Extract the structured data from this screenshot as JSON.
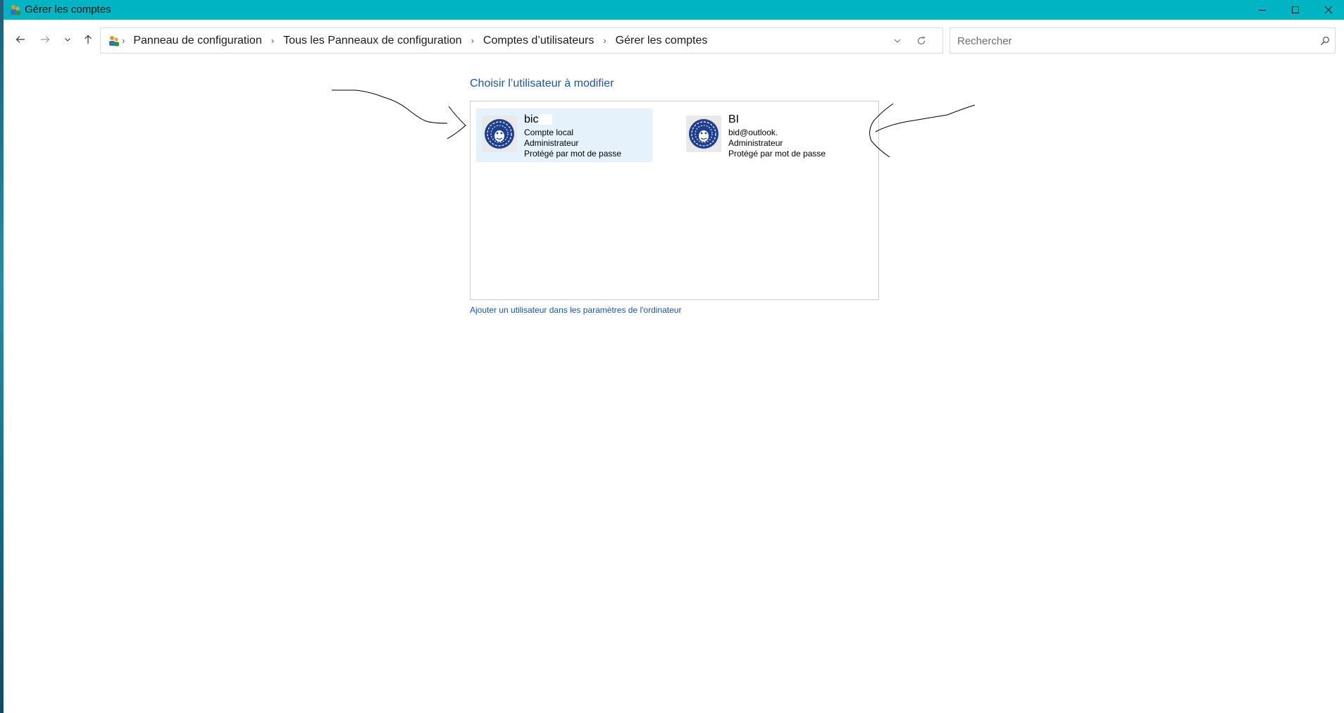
{
  "window": {
    "title": "Gérer les comptes",
    "icon": "user-accounts-icon"
  },
  "titlebar": {
    "minimize_icon": "minimize-icon",
    "maximize_icon": "maximize-icon",
    "close_icon": "close-icon"
  },
  "navigation": {
    "back_icon": "arrow-left-icon",
    "forward_icon": "arrow-right-icon",
    "recent_icon": "chevron-down-icon",
    "up_icon": "arrow-up-icon"
  },
  "breadcrumb": [
    "Panneau de configuration",
    "Tous les Panneaux de configuration",
    "Comptes d’utilisateurs",
    "Gérer les comptes"
  ],
  "search": {
    "placeholder": "Rechercher"
  },
  "main": {
    "heading": "Choisir l’utilisateur à modifier",
    "users": [
      {
        "name": "bic",
        "type": "Compte local",
        "role": "Administrateur",
        "protection": "Protégé par mot de passe",
        "selected": true
      },
      {
        "name": "BI",
        "email": "bid@outlook.",
        "role": "Administrateur",
        "protection": "Protégé par mot de passe",
        "selected": false
      }
    ],
    "add_user_link": "Ajouter un utilisateur dans les paramètres de l'ordinateur"
  },
  "colors": {
    "titlebar": "#00b4c4",
    "link": "#1a55a8",
    "selected_tile": "#e5f1fb"
  }
}
